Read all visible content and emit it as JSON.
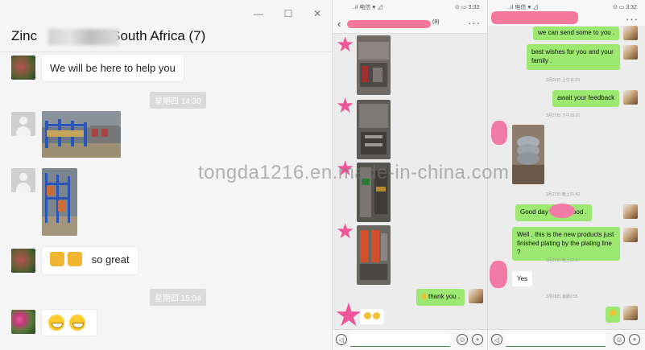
{
  "desktop": {
    "window_controls": {
      "minimize": "—",
      "maximize": "☐",
      "close": "✕"
    },
    "title": "Zinc",
    "title_suffix": "South Africa (7)",
    "messages": [
      {
        "text": "We will be here to help you"
      },
      {
        "time": "星期四 14:30"
      },
      {
        "text": "so great"
      },
      {
        "time": "星期四 15:04"
      }
    ]
  },
  "phone1": {
    "status_left": "..ıl 电信 ♥ ⊿",
    "status_right": "⊙ ▭ 3:33",
    "title_suffix": "(8)",
    "reply": "thank you ."
  },
  "phone2": {
    "status_left": "..ıl 电信 ♥ ⊿",
    "status_right": "⊙ ▭ 3:32",
    "messages": [
      {
        "text": "we can send some to you ."
      },
      {
        "text": "best wishes for you and your family ."
      },
      {
        "time": "3月26日 上午11:23"
      },
      {
        "text": "await your feedback"
      },
      {
        "time": "3月27日 下午16:21"
      },
      {
        "time": "3月27日 晚上21:42"
      },
      {
        "text": "Good day        Looks good ."
      },
      {
        "text": "Well , this is the new products just finished plating by the plating line ?"
      },
      {
        "time": "3月27日 晚上22:57"
      },
      {
        "text": "Yes"
      },
      {
        "time": "3月28日 凌晨0:55"
      }
    ]
  },
  "watermark": "TONGDA1216.en.made-in-china.com",
  "watermark_display": "tongda1216.en.made-in-china.com",
  "colors": {
    "wechat_green": "#9de871",
    "pink_redaction": "#f3789a"
  }
}
